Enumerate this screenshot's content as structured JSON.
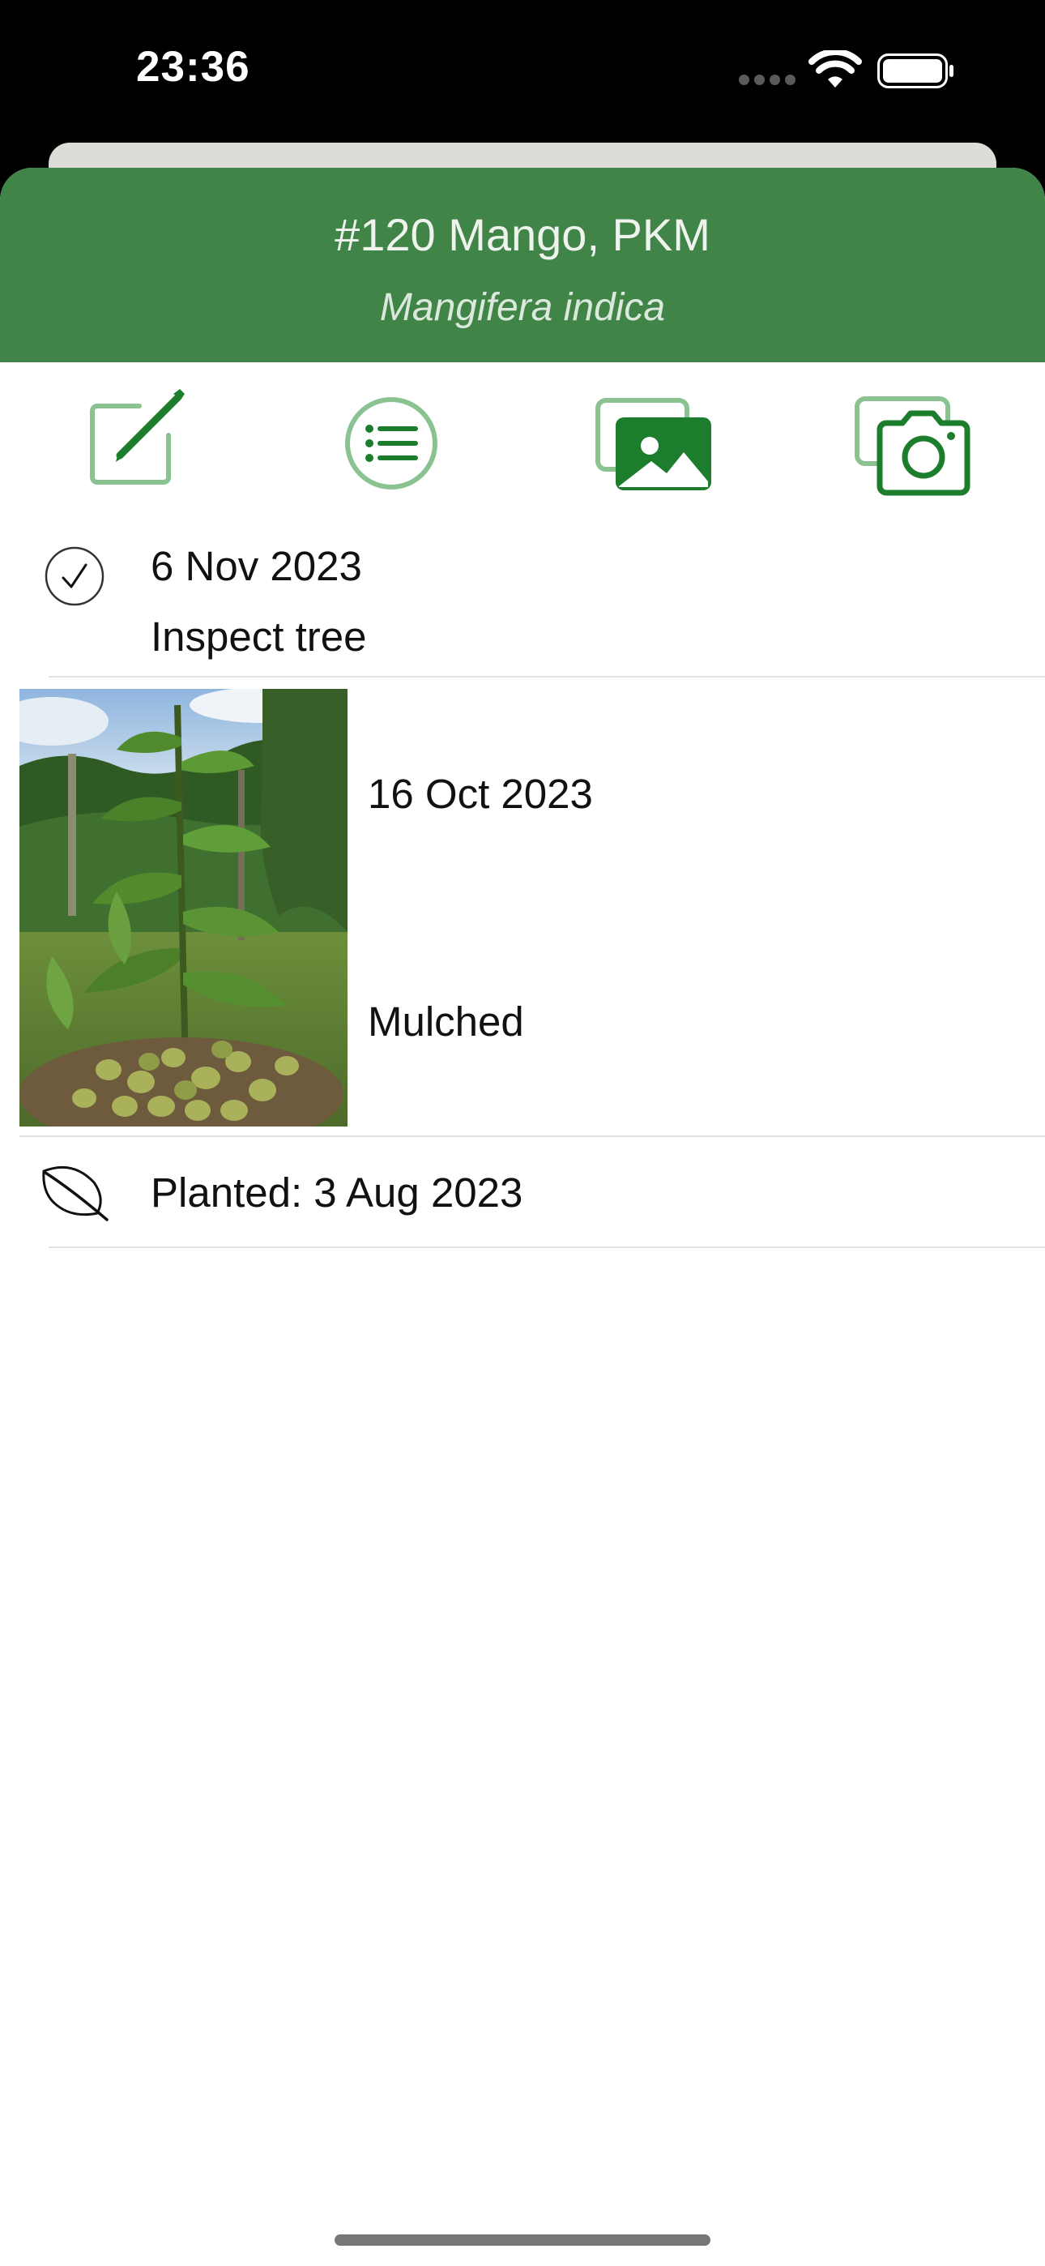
{
  "status_bar": {
    "time": "23:36",
    "icons": [
      "signal-dots-icon",
      "wifi-icon",
      "battery-icon"
    ]
  },
  "header": {
    "title": "#120 Mango, PKM",
    "subtitle": "Mangifera indica",
    "background": "#418447"
  },
  "toolbar": {
    "buttons": [
      {
        "icon": "edit-note-icon"
      },
      {
        "icon": "list-icon"
      },
      {
        "icon": "photo-gallery-icon"
      },
      {
        "icon": "camera-icon"
      }
    ],
    "accent_light": "#8bc292",
    "accent_dark": "#1c7d2c"
  },
  "rows": [
    {
      "icon": "checkmark-circle-icon",
      "date": "6 Nov 2023",
      "note": "Inspect tree"
    },
    {
      "icon": "tree-photo-thumbnail",
      "date": "16 Oct 2023",
      "note": "Mulched"
    },
    {
      "icon": "leaf-icon",
      "text": "Planted: 3 Aug 2023"
    }
  ]
}
